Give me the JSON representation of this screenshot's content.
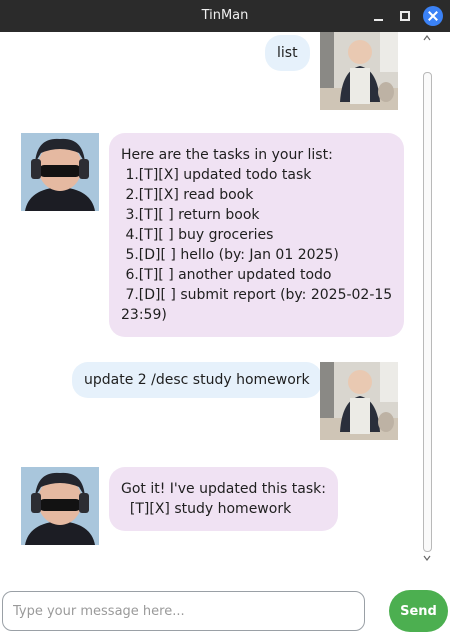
{
  "window": {
    "title": "TinMan"
  },
  "messages": [
    {
      "sender": "user",
      "text": "list"
    },
    {
      "sender": "bot",
      "text": "Here are the tasks in your list:\n 1.[T][X] updated todo task\n 2.[T][X] read book\n 3.[T][ ] return book\n 4.[T][ ] buy groceries\n 5.[D][ ] hello (by: Jan 01 2025)\n 6.[T][ ] another updated todo\n 7.[D][ ] submit report (by: 2025-02-15\n23:59)"
    },
    {
      "sender": "user",
      "text": "update 2 /desc study homework"
    },
    {
      "sender": "bot",
      "text": "Got it! I've updated this task:\n  [T][X] study homework"
    }
  ],
  "input": {
    "placeholder": "Type your message here..."
  },
  "send_button": {
    "label": "Send"
  },
  "colors": {
    "user_bubble": "#e6f1fb",
    "bot_bubble": "#f0e2f3",
    "send": "#4caf50",
    "close": "#3b82f6"
  }
}
